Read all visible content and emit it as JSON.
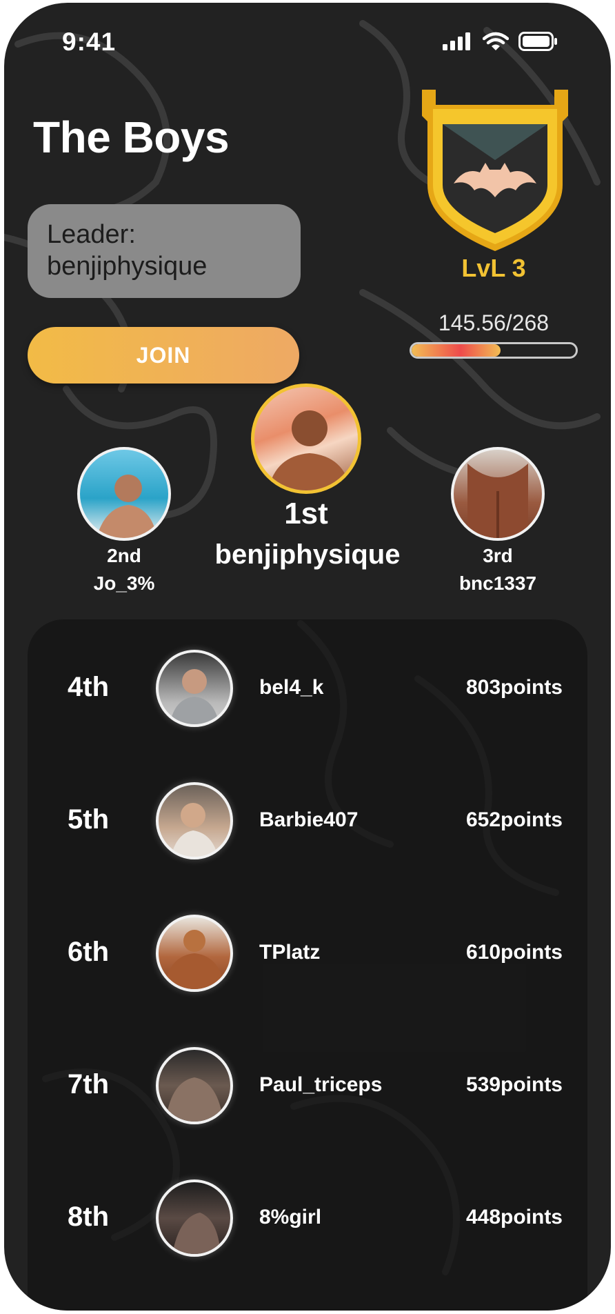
{
  "status_bar": {
    "time": "9:41"
  },
  "group": {
    "title": "The Boys",
    "leader_label": "Leader:",
    "leader_name": "benjiphysique",
    "join_label": "JOIN"
  },
  "level": {
    "label": "LvL 3",
    "xp_text": "145.56/268",
    "progress_fraction": 0.54
  },
  "podium": [
    {
      "place": "1st",
      "username": "benjiphysique"
    },
    {
      "place": "2nd",
      "username": "Jo_3%"
    },
    {
      "place": "3rd",
      "username": "bnc1337"
    }
  ],
  "leaderboard": [
    {
      "rank": "4th",
      "username": "bel4_k",
      "points": "803points"
    },
    {
      "rank": "5th",
      "username": "Barbie407",
      "points": "652points"
    },
    {
      "rank": "6th",
      "username": "TPlatz",
      "points": "610points"
    },
    {
      "rank": "7th",
      "username": "Paul_triceps",
      "points": "539points"
    },
    {
      "rank": "8th",
      "username": "8%girl",
      "points": "448points"
    }
  ],
  "colors": {
    "background": "#222222",
    "accent_gold": "#f2c233",
    "join_gradient_start": "#f2bb46",
    "join_gradient_end": "#eea964",
    "leader_box": "#8a8a8a"
  },
  "icons": {
    "signal": "cellular-signal-icon",
    "wifi": "wifi-icon",
    "battery": "battery-icon",
    "badge": "bat-shield-badge-icon"
  }
}
